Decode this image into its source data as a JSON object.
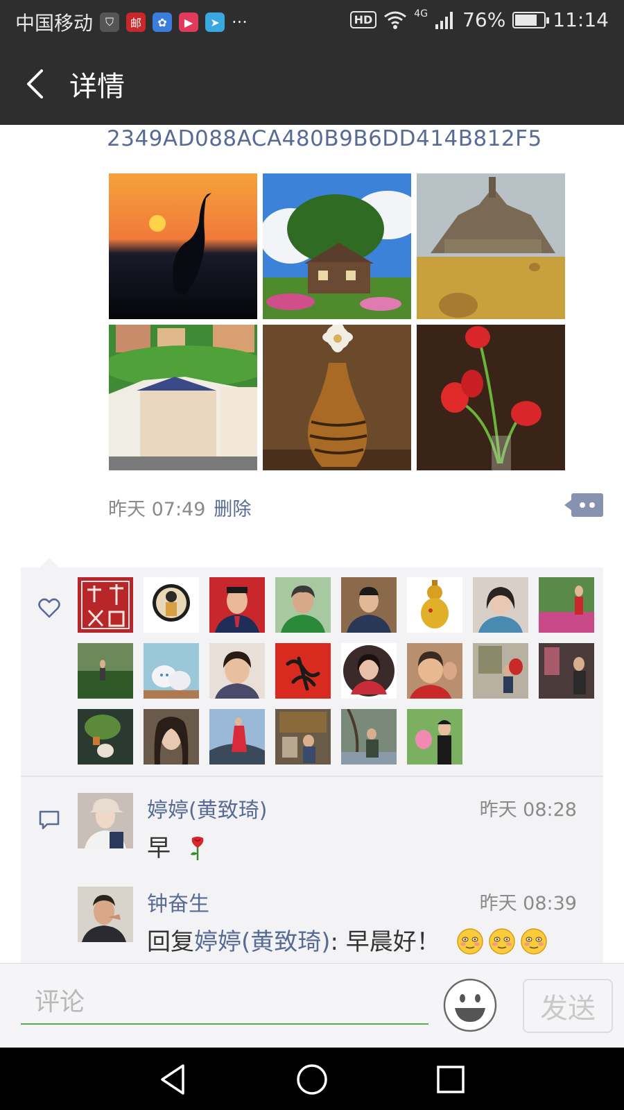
{
  "status_bar": {
    "carrier": "中国移动",
    "hd": "HD",
    "network": "4G",
    "battery": "76%",
    "battery_level": 0.76,
    "time": "11:14",
    "more": "···",
    "app_icons": [
      "shield-icon",
      "china-post-icon",
      "baidu-icon",
      "video-app-icon",
      "telegram-icon"
    ]
  },
  "header": {
    "title": "详情"
  },
  "post": {
    "text": "2349AD088ACA480B9B6DD414B812F5",
    "photos": [
      "heron-sunset-photo",
      "cottage-photo",
      "castle-photo",
      "town-photo",
      "vase-flower-photo",
      "red-tulips-photo"
    ],
    "time": "昨天 07:49",
    "delete_label": "删除"
  },
  "likes": {
    "avatar_count": 22
  },
  "comments": [
    {
      "name": "婷婷(黄致琦)",
      "time": "昨天 08:28",
      "text": "早"
    },
    {
      "name": "钟奋生",
      "time": "昨天 08:39",
      "reply_prefix": "回复",
      "reply_target": "婷婷(黄致琦)",
      "reply_text": ": 早晨好！"
    }
  ],
  "input_bar": {
    "placeholder": "评论",
    "send_label": "发送"
  },
  "colors": {
    "link": "#576b95",
    "accent_green": "#4cb04c",
    "bar_dark": "#2e2e2e"
  }
}
